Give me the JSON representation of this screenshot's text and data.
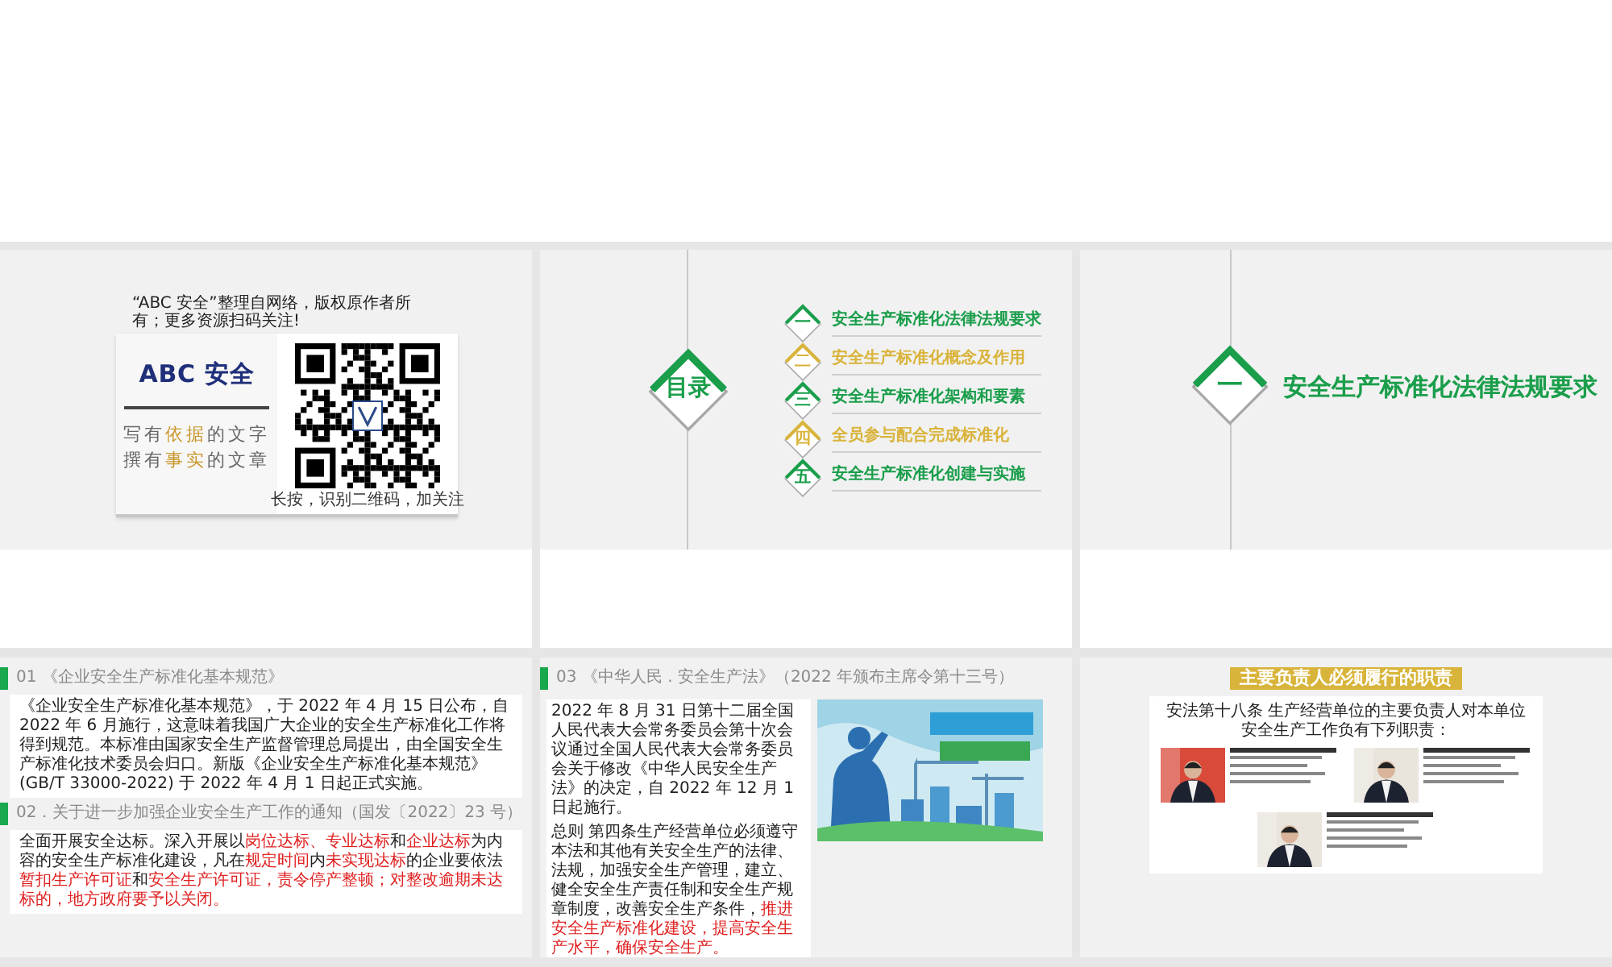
{
  "slides": [
    {
      "kind": "promo",
      "note": "“ABC 安全”整理自网络，版权原作者所有；更多资源扫码关注!",
      "brand": "ABC 安全",
      "slogans": [
        [
          {
            "text": "写有"
          },
          {
            "text": "依据",
            "highlight": true
          },
          {
            "text": "的文字"
          }
        ],
        [
          {
            "text": "撰有"
          },
          {
            "text": "事实",
            "highlight": true
          },
          {
            "text": "的文章"
          }
        ]
      ],
      "qr_caption": "长按，识别二维码，加关注"
    },
    {
      "kind": "toc",
      "title": "目录",
      "items": [
        {
          "number": "一",
          "label": "安全生产标准化法律法规要求",
          "color": "#1a9e4b"
        },
        {
          "number": "二",
          "label": "安全生产标准化概念及作用",
          "color": "#d9b43c"
        },
        {
          "number": "三",
          "label": "安全生产标准化架构和要素",
          "color": "#1a9e4b"
        },
        {
          "number": "四",
          "label": "全员参与配合完成标准化",
          "color": "#d9b43c"
        },
        {
          "number": "五",
          "label": "安全生产标准化创建与实施",
          "color": "#1a9e4b"
        }
      ]
    },
    {
      "kind": "section",
      "number": "一",
      "title": "安全生产标准化法律法规要求"
    },
    {
      "kind": "text",
      "blocks": [
        {
          "heading": "01 《企业安全生产标准化基本规范》",
          "paragraph": [
            {
              "text": "《企业安全生产标准化基本规范》，于 2022 年 4 月 15 日公布，自 2022 年 6 月施行，这意味着我国广大企业的安全生产标准化工作将得到规范。本标准由国家安全生产监督管理总局提出，由全国安全生产标准化技术委员会归口。新版《企业安全生产标准化基本规范》(GB/T 33000-2022) 于 2022 年 4 月 1 日起正式实施。"
            }
          ]
        },
        {
          "heading": "02．关于进一步加强企业安全生产工作的通知（国发〔2022〕23 号）",
          "paragraph": [
            {
              "text": "全面开展安全达标。深入开展以"
            },
            {
              "text": "岗位达标、专业达标",
              "red": true
            },
            {
              "text": "和"
            },
            {
              "text": "企业达标",
              "red": true
            },
            {
              "text": "为内容的安全生产标准化建设，凡在"
            },
            {
              "text": "规定时间",
              "red": true
            },
            {
              "text": "内"
            },
            {
              "text": "未实现达标",
              "red": true
            },
            {
              "text": "的企业要依法"
            },
            {
              "text": "暂扣生产许可证",
              "red": true
            },
            {
              "text": "和"
            },
            {
              "text": "安全生产许可证，责令停产整顿；",
              "red": true
            },
            {
              "text": "对整改逾期未达标的，地方政府要予以关闭。",
              "red": true
            }
          ]
        }
      ]
    },
    {
      "kind": "law",
      "heading": "03 《中华人民 . 安全生产法》（2022 年颁布主席令第十三号）",
      "paragraphs": [
        [
          {
            "text": "2022 年 8 月 31 日第十二届全国人民代表大会常务委员会第十次会议通过全国人民代表大会常务委员会关于修改《中华人民安全生产法》的决定，自 2022 年 12 月 1 日起施行。"
          }
        ],
        [
          {
            "text": "总则 第四条生产经营单位必须遵守本法和其他有关安全生产的法律、法规，加强安全生产管理，建立、健全安全生产责任制和安全生产规章制度，改善安全生产条件，"
          },
          {
            "text": "推进安全生产标准化建设，提高安全生产水平，确保安全生产。",
            "red": true
          }
        ]
      ]
    },
    {
      "kind": "duties",
      "title": "主要负责人必须履行的职责",
      "intro": "安法第十八条 生产经营单位的主要负责人对本单位安全生产工作负有下列职责："
    }
  ]
}
